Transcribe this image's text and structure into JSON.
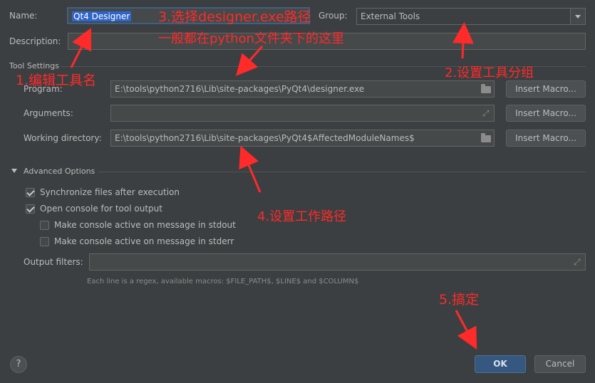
{
  "form": {
    "name_label": "Name:",
    "name_value": "Qt4 Designer",
    "group_label": "Group:",
    "group_value": "External Tools",
    "description_label": "Description:",
    "description_value": ""
  },
  "tool_settings": {
    "title": "Tool Settings",
    "program_label": "Program:",
    "program_value": "E:\\tools\\python2716\\Lib\\site-packages\\PyQt4\\designer.exe",
    "arguments_label": "Arguments:",
    "arguments_value": "",
    "workdir_label": "Working directory:",
    "workdir_value": "E:\\tools\\python2716\\Lib\\site-packages\\PyQt4$AffectedModuleNames$",
    "insert_macro_label": "Insert Macro..."
  },
  "advanced": {
    "title": "Advanced Options",
    "options": [
      {
        "label": "Synchronize files after execution",
        "checked": true
      },
      {
        "label": "Open console for tool output",
        "checked": true
      },
      {
        "label": "Make console active on message in stdout",
        "checked": false
      },
      {
        "label": "Make console active on message in stderr",
        "checked": false
      }
    ],
    "output_filters_label": "Output filters:",
    "output_filters_value": "",
    "hint": "Each line is a regex, available macros: $FILE_PATH$, $LINE$ and $COLUMN$"
  },
  "buttons": {
    "help": "?",
    "ok": "OK",
    "cancel": "Cancel"
  },
  "annotations": {
    "a1": "1.编辑工具名",
    "a2": "2.设置工具分组",
    "a3_line1": "3.选择designer.exe路径",
    "a3_line2": "一般都在python文件夹下的这里",
    "a4": "4.设置工作路径",
    "a5": "5.搞定"
  },
  "colors": {
    "annotation": "#ff2a2a",
    "ok_button": "#365880",
    "background": "#3c3f41"
  }
}
